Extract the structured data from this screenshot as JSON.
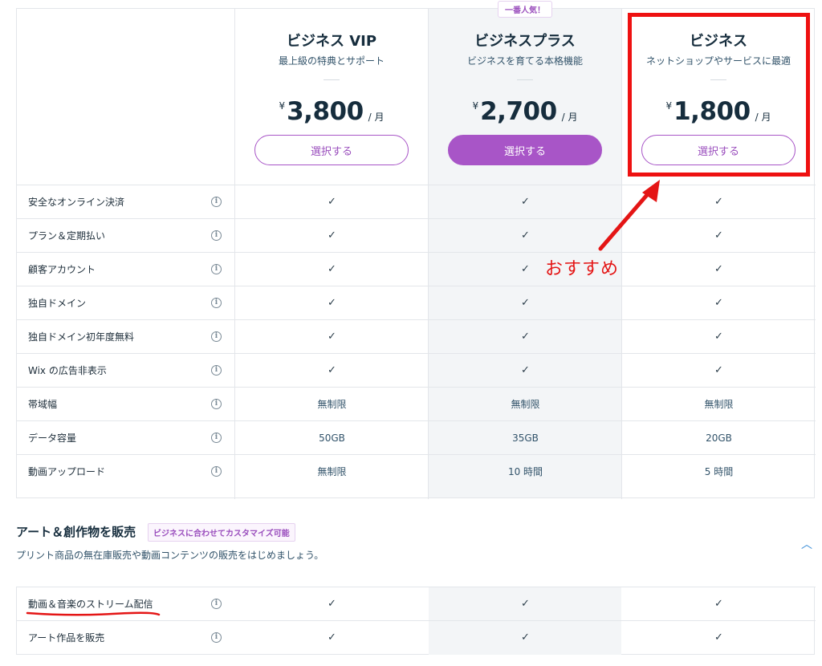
{
  "plans": [
    {
      "name": "ビジネス VIP",
      "subtitle": "最上級の特典とサポート",
      "currency": "¥",
      "price": "3,800",
      "per": "/ 月",
      "button": "選択する",
      "badge": ""
    },
    {
      "name": "ビジネスプラス",
      "subtitle": "ビジネスを育てる本格機能",
      "currency": "¥",
      "price": "2,700",
      "per": "/ 月",
      "button": "選択する",
      "badge": "一番人気！"
    },
    {
      "name": "ビジネス",
      "subtitle": "ネットショップやサービスに最適",
      "currency": "¥",
      "price": "1,800",
      "per": "/ 月",
      "button": "選択する",
      "badge": ""
    }
  ],
  "features": [
    {
      "label": "安全なオンライン決済",
      "values": [
        "✓",
        "✓",
        "✓"
      ]
    },
    {
      "label": "プラン＆定期払い",
      "values": [
        "✓",
        "✓",
        "✓"
      ]
    },
    {
      "label": "顧客アカウント",
      "values": [
        "✓",
        "✓",
        "✓"
      ]
    },
    {
      "label": "独自ドメイン",
      "values": [
        "✓",
        "✓",
        "✓"
      ]
    },
    {
      "label": "独自ドメイン初年度無料",
      "values": [
        "✓",
        "✓",
        "✓"
      ]
    },
    {
      "label": "Wix の広告非表示",
      "values": [
        "✓",
        "✓",
        "✓"
      ]
    },
    {
      "label": "帯域幅",
      "values": [
        "無制限",
        "無制限",
        "無制限"
      ]
    },
    {
      "label": "データ容量",
      "values": [
        "50GB",
        "35GB",
        "20GB"
      ]
    },
    {
      "label": "動画アップロード",
      "values": [
        "無制限",
        "10 時間",
        "5 時間"
      ]
    }
  ],
  "annotation": {
    "recommend": "おすすめ"
  },
  "section": {
    "title": "アート＆創作物を販売",
    "badge": "ビジネスに合わせてカスタマイズ可能",
    "description": "プリント商品の無在庫販売や動画コンテンツの販売をはじめましょう。",
    "features": [
      {
        "label": "動画＆音楽のストリーム配信",
        "values": [
          "✓",
          "✓",
          "✓"
        ]
      },
      {
        "label": "アート作品を販売",
        "values": [
          "✓",
          "✓",
          "✓"
        ]
      }
    ]
  },
  "icons": {
    "info": "info-icon",
    "check": "check-icon",
    "collapse": "chevron-up-icon"
  },
  "colors": {
    "accent": "#a855c7",
    "highlight_red": "#ee1111",
    "shade": "#f3f5f7"
  }
}
